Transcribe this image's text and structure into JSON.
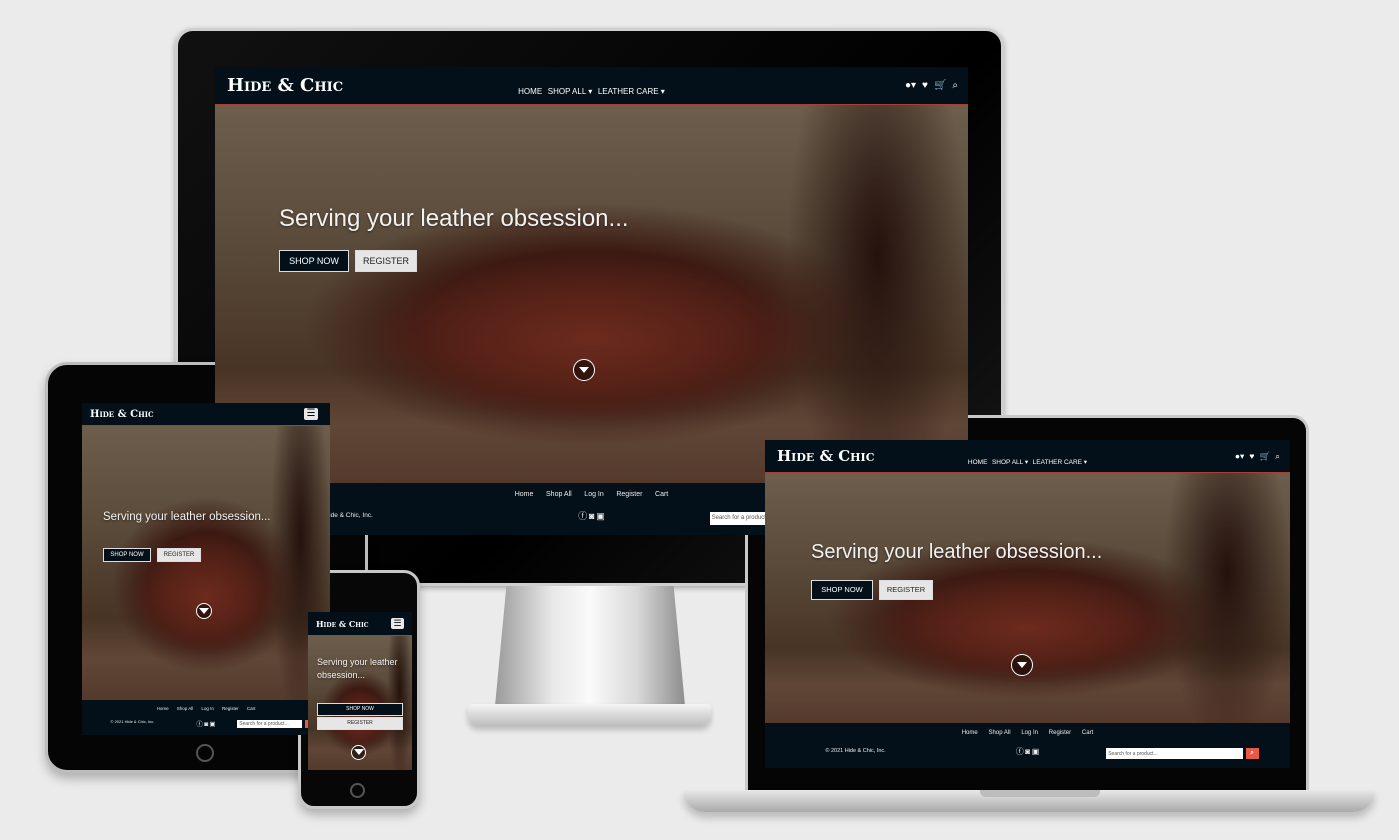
{
  "site": {
    "logo": "Hide & Chic",
    "nav": [
      "HOME",
      "SHOP ALL ▾",
      "LEATHER CARE ▾"
    ],
    "nav_icons": [
      "user-icon",
      "heart-icon",
      "cart-icon",
      "search-icon"
    ],
    "hero_title": "Serving your leather obsession...",
    "shop_now": "SHOP NOW",
    "register": "REGISTER",
    "footer_links": [
      "Home",
      "Shop All",
      "Log In",
      "Register",
      "Cart"
    ],
    "social_icons": [
      "facebook-icon",
      "instagram-icon",
      "youtube-icon"
    ],
    "copyright": "© 2021 Hide & Chic, Inc.",
    "search_placeholder": "Search for a product..."
  },
  "devices": [
    "desktop",
    "tablet",
    "phone",
    "laptop"
  ],
  "colors": {
    "nav_bg": "#03101a",
    "accent": "#e85a45",
    "background": "#ebebeb"
  }
}
